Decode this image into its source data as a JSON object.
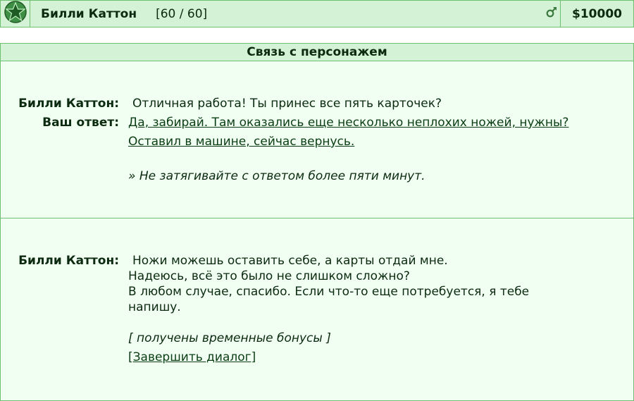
{
  "header": {
    "player_name": "Билли Каттон",
    "hp": "[60 / 60]",
    "money": "$10000",
    "gender_icon": "male-icon",
    "rank_icon": "star-icon"
  },
  "panel": {
    "title": "Связь с персонажем",
    "first": {
      "speaker": "Билли Каттон:",
      "message": "Отличная работа! Ты принес все пять карточек?",
      "answer_label": "Ваш ответ:",
      "answers": [
        "Да, забирай. Там оказались еще несколько неплохих ножей, нужны?",
        "Оставил в машине, сейчас вернусь."
      ],
      "note": "» Не затягивайте с ответом более пяти минут."
    },
    "second": {
      "speaker": "Билли Каттон:",
      "lines": [
        "Ножи можешь оставить себе, а карты отдай мне.",
        "Надеюсь, всё это было не слишком сложно?",
        "В любом случае, спасибо. Если что-то еще потребуется, я тебе",
        "напишу."
      ],
      "bonus": "[ получены временные бонусы ]",
      "end_link": "[Завершить диалог]"
    }
  },
  "colors": {
    "accent": "#6fbf73",
    "header_bg": "#d4f2d6",
    "panel_bg": "#f1fff2",
    "text": "#0b2a10"
  }
}
